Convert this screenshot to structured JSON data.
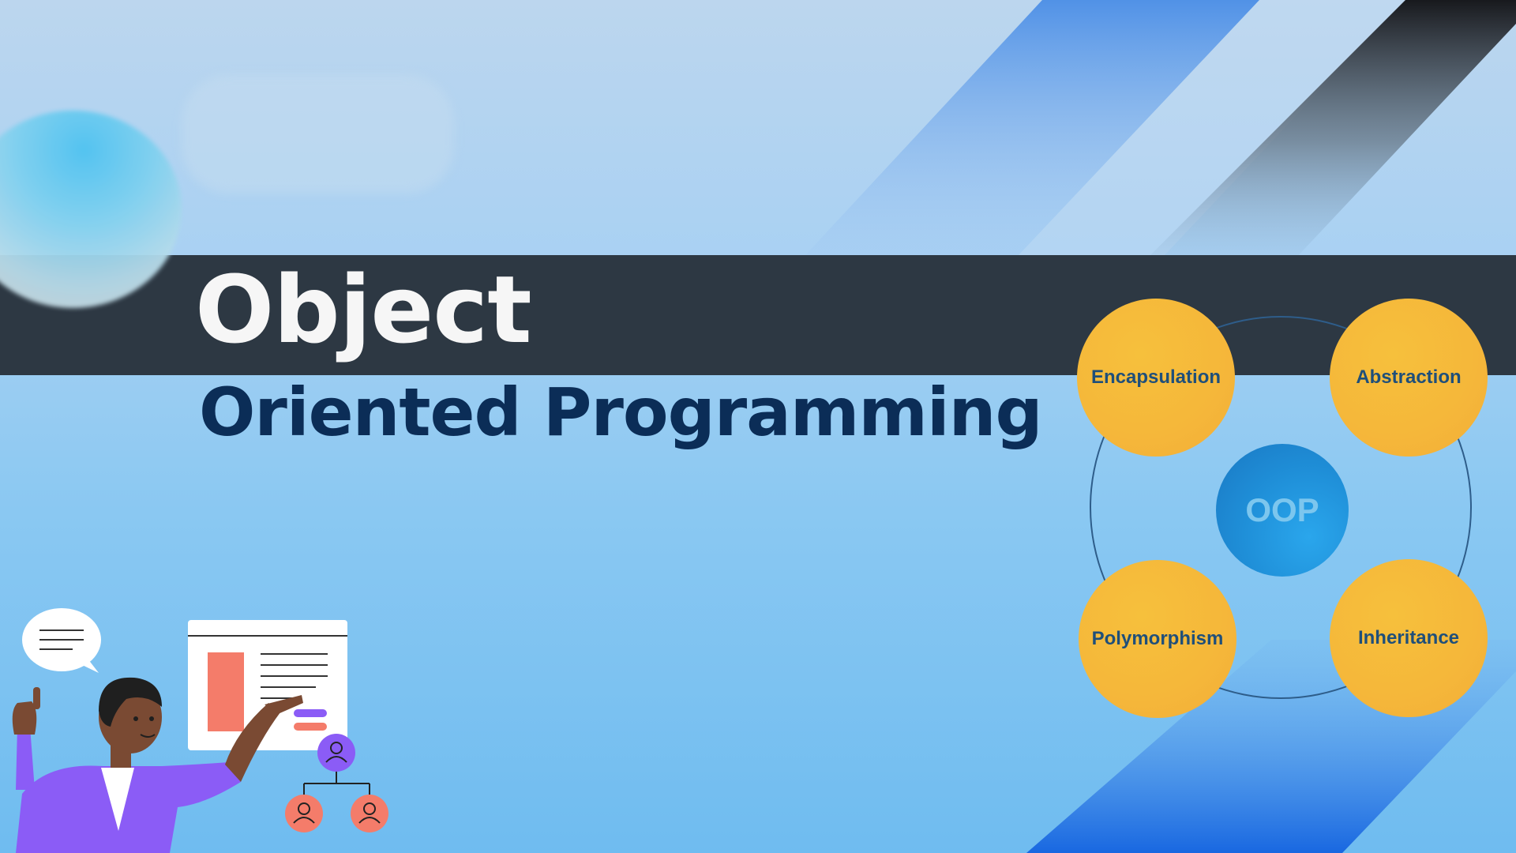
{
  "title": {
    "line1": "Object",
    "line2": "Oriented Programming"
  },
  "diagram": {
    "center_label": "OOP",
    "nodes": {
      "encapsulation": "Encapsulation",
      "abstraction": "Abstraction",
      "polymorphism": "Polymorphism",
      "inheritance": "Inheritance"
    }
  },
  "colors": {
    "band": "#2d3843",
    "title_light": "#f6f6f6",
    "title_dark": "#0b2d57",
    "node_fill": "#f5b73a",
    "node_text": "#1f4f7a",
    "center_fill": "#1f8fd8"
  },
  "icons": [
    "speech-bubble-icon",
    "presenter-illustration",
    "slide-board-icon",
    "org-chart-icon",
    "user-icon"
  ]
}
